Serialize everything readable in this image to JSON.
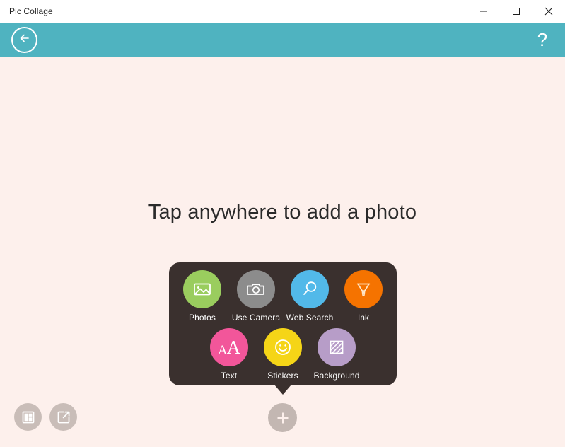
{
  "window": {
    "title": "Pic Collage",
    "controls": [
      {
        "name": "minimize",
        "label": "—"
      },
      {
        "name": "maximize",
        "label": "☐"
      },
      {
        "name": "close",
        "label": "✕"
      }
    ]
  },
  "appbar": {
    "back_icon": "arrow-left-circle-icon",
    "help_label": "?"
  },
  "canvas": {
    "hint": "Tap anywhere to add a photo"
  },
  "popup": {
    "rows": [
      [
        {
          "label": "Photos",
          "icon": "image-icon",
          "color": "#9acd5e"
        },
        {
          "label": "Use Camera",
          "icon": "camera-icon",
          "color": "#8c8c8c"
        },
        {
          "label": "Web Search",
          "icon": "magnifier-icon",
          "color": "#52b9e9"
        },
        {
          "label": "Ink",
          "icon": "marker-pen-icon",
          "color": "#f57300"
        }
      ],
      [
        {
          "label": "Text",
          "icon": "text-aa-icon",
          "color": "#f2569a"
        },
        {
          "label": "Stickers",
          "icon": "smiley-icon",
          "color": "#f5d517"
        },
        {
          "label": "Background",
          "icon": "hatched-square-icon",
          "color": "#b79dc8"
        }
      ]
    ]
  },
  "toolbar": {
    "layout_icon": "layout-grid-icon",
    "export_icon": "export-icon",
    "add_icon": "plus-icon"
  },
  "colors": {
    "accent_teal": "#4fb3c0",
    "canvas_bg": "#fdf0ec",
    "panel_dark": "#3a302e",
    "button_gray": "#c9bdb8"
  }
}
